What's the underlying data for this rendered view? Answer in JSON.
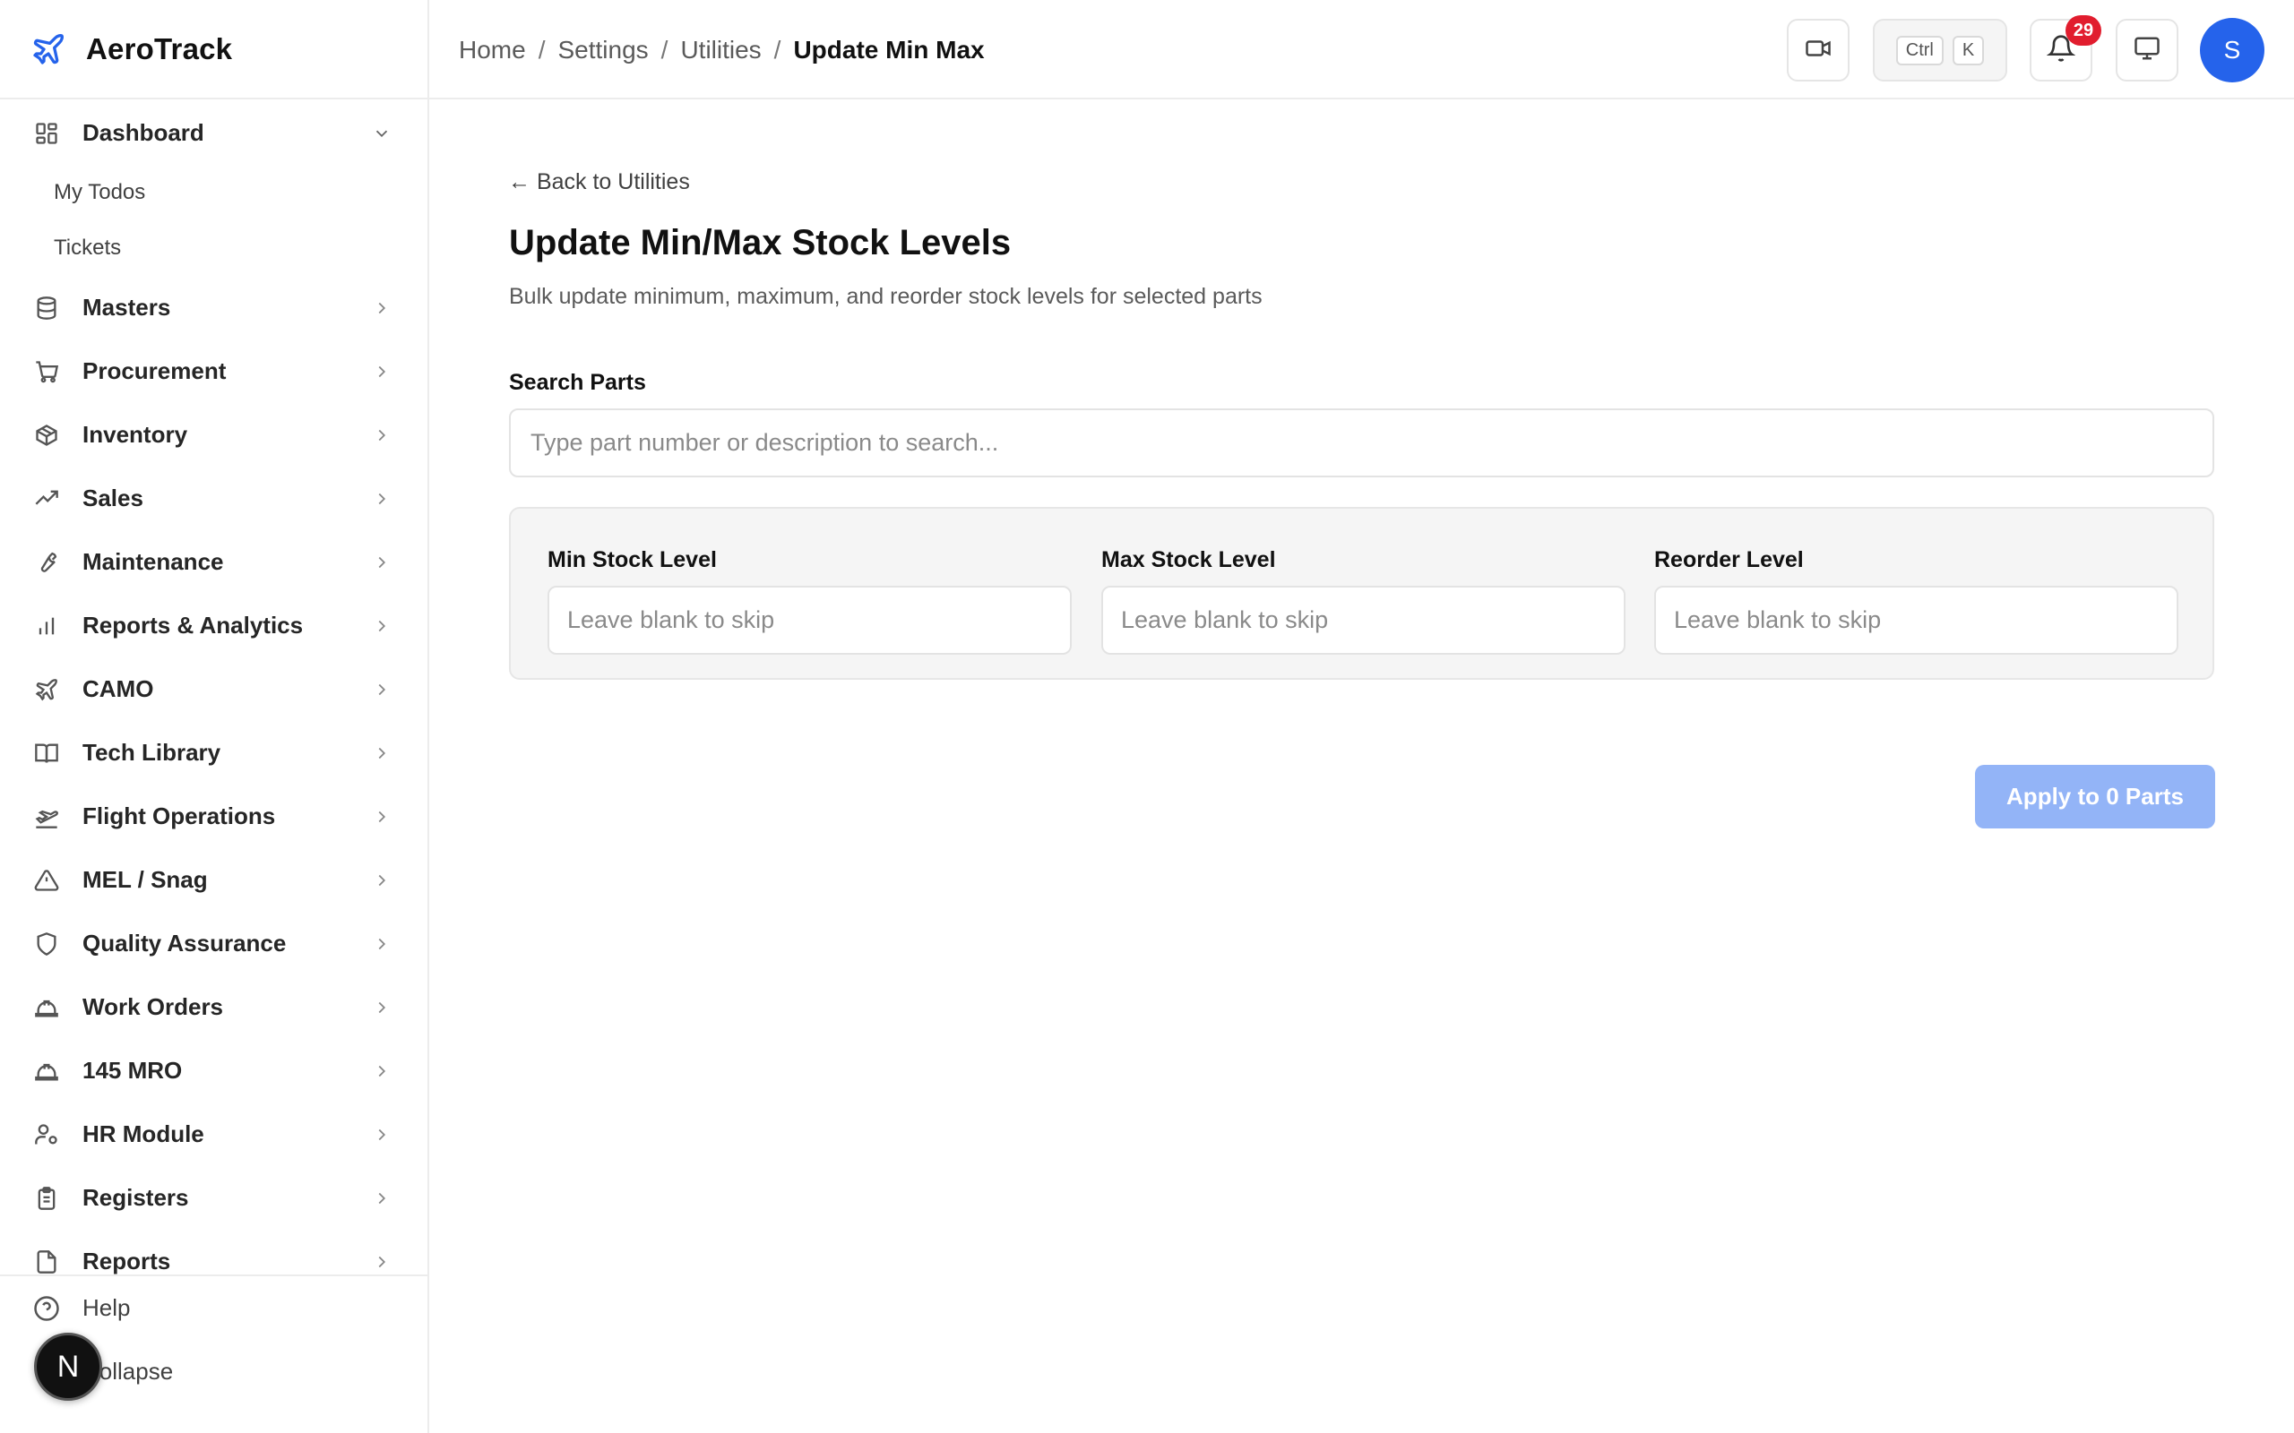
{
  "app": {
    "name": "AeroTrack"
  },
  "sidebar": {
    "items": [
      {
        "label": "Dashboard",
        "icon": "dashboard-icon",
        "expanded": true,
        "children": [
          {
            "label": "My Todos"
          },
          {
            "label": "Tickets"
          }
        ]
      },
      {
        "label": "Masters",
        "icon": "database-icon"
      },
      {
        "label": "Procurement",
        "icon": "cart-icon"
      },
      {
        "label": "Inventory",
        "icon": "package-icon"
      },
      {
        "label": "Sales",
        "icon": "trending-up-icon"
      },
      {
        "label": "Maintenance",
        "icon": "wrench-icon"
      },
      {
        "label": "Reports & Analytics",
        "icon": "bar-chart-icon"
      },
      {
        "label": "CAMO",
        "icon": "plane-icon"
      },
      {
        "label": "Tech Library",
        "icon": "book-icon"
      },
      {
        "label": "Flight Operations",
        "icon": "plane-takeoff-icon"
      },
      {
        "label": "MEL / Snag",
        "icon": "warning-icon"
      },
      {
        "label": "Quality Assurance",
        "icon": "shield-icon"
      },
      {
        "label": "Work Orders",
        "icon": "hard-hat-icon"
      },
      {
        "label": "145 MRO",
        "icon": "hard-hat-icon"
      },
      {
        "label": "HR Module",
        "icon": "user-cog-icon"
      },
      {
        "label": "Registers",
        "icon": "clipboard-icon"
      },
      {
        "label": "Reports",
        "icon": "file-icon"
      }
    ],
    "footer": {
      "help_label": "Help",
      "collapse_label": "Collapse",
      "badge_letter": "N"
    }
  },
  "header": {
    "breadcrumb": [
      {
        "label": "Home"
      },
      {
        "label": "Settings"
      },
      {
        "label": "Utilities"
      },
      {
        "label": "Update Min Max"
      }
    ],
    "separator": "/",
    "shortcut": {
      "key1": "Ctrl",
      "key2": "K"
    },
    "notification_count": "29",
    "avatar_initial": "S"
  },
  "main": {
    "back_link": "← Back to Utilities",
    "title": "Update Min/Max Stock Levels",
    "subtitle": "Bulk update minimum, maximum, and reorder stock levels for selected parts",
    "search": {
      "label": "Search Parts",
      "placeholder": "Type part number or description to search...",
      "value": ""
    },
    "fields": {
      "min": {
        "label": "Min Stock Level",
        "placeholder": "Leave blank to skip"
      },
      "max": {
        "label": "Max Stock Level",
        "placeholder": "Leave blank to skip"
      },
      "reorder": {
        "label": "Reorder Level",
        "placeholder": "Leave blank to skip"
      }
    },
    "apply_button": "Apply to 0 Parts"
  },
  "colors": {
    "accent": "#2563eb",
    "apply_disabled": "#93b4f7",
    "notification_badge": "#e11d2e",
    "panel_bg": "#f5f5f5"
  }
}
